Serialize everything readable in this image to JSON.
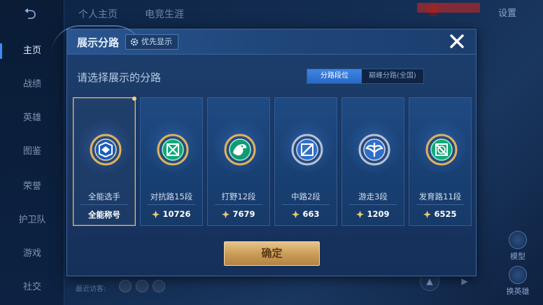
{
  "background": {
    "sidebar": [
      "主页",
      "战绩",
      "英雄",
      "图鉴",
      "荣誉",
      "护卫队",
      "游戏",
      "社交"
    ],
    "tabs": [
      "个人主页",
      "电竞生涯"
    ],
    "settings_label": "设置",
    "right_buttons": [
      "模型",
      "换英雄"
    ],
    "visitors_label": "最近访客:"
  },
  "dialog": {
    "title": "展示分路",
    "priority_label": "优先显示",
    "subtitle": "请选择展示的分路",
    "toggles": [
      {
        "label": "分路段位",
        "active": true
      },
      {
        "label": "巅峰分路(全国)",
        "active": false
      }
    ],
    "lanes": [
      {
        "name": "全能选手",
        "value": "全能称号",
        "selected": true,
        "icon": "all-round-emblem-icon",
        "accent": "#e0b35c"
      },
      {
        "name": "对抗路15段",
        "value": "10726",
        "selected": false,
        "icon": "clash-lane-emblem-icon",
        "accent": "#2bd08a"
      },
      {
        "name": "打野12段",
        "value": "7679",
        "selected": false,
        "icon": "jungle-emblem-icon",
        "accent": "#22c08a"
      },
      {
        "name": "中路2段",
        "value": "663",
        "selected": false,
        "icon": "mid-lane-emblem-icon",
        "accent": "#9fb2cc"
      },
      {
        "name": "游走3段",
        "value": "1209",
        "selected": false,
        "icon": "roam-emblem-icon",
        "accent": "#9fb2cc"
      },
      {
        "name": "发育路11段",
        "value": "6525",
        "selected": false,
        "icon": "farm-lane-emblem-icon",
        "accent": "#23c78e"
      }
    ],
    "confirm_label": "确定"
  }
}
